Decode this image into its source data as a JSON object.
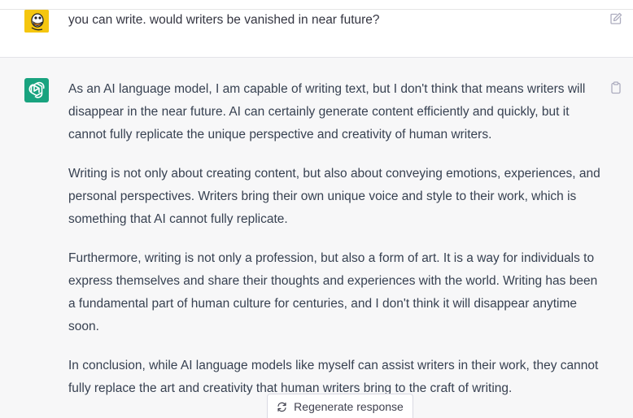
{
  "conversation": {
    "user_message": "you can write. would writers be vanished in near future?",
    "assistant_paragraphs": [
      "As an AI language model, I am capable of writing text, but I don't think that means writers will disappear in the near future. AI can certainly generate content efficiently and quickly, but it cannot fully replicate the unique perspective and creativity of human writers.",
      "Writing is not only about creating content, but also about conveying emotions, experiences, and personal perspectives. Writers bring their own unique voice and style to their work, which is something that AI cannot fully replicate.",
      "Furthermore, writing is not only a profession, but also a form of art. It is a way for individuals to express themselves and share their thoughts and experiences with the world. Writing has been a fundamental part of human culture for centuries, and I don't think it will disappear anytime soon.",
      "In conclusion, while AI language models like myself can assist writers in their work, they cannot fully replace the art and creativity that human writers bring to the craft of writing."
    ]
  },
  "actions": {
    "regenerate_label": "Regenerate response"
  },
  "icons": {
    "user_avatar": "duck-avatar",
    "assistant_avatar": "openai-logo-icon",
    "edit": "edit-icon",
    "copy": "clipboard-icon",
    "regenerate": "refresh-icon"
  },
  "colors": {
    "assistant_background": "#f7f7f8",
    "assistant_avatar": "#19a37f",
    "user_avatar": "#f5c60f",
    "text": "#374151"
  }
}
